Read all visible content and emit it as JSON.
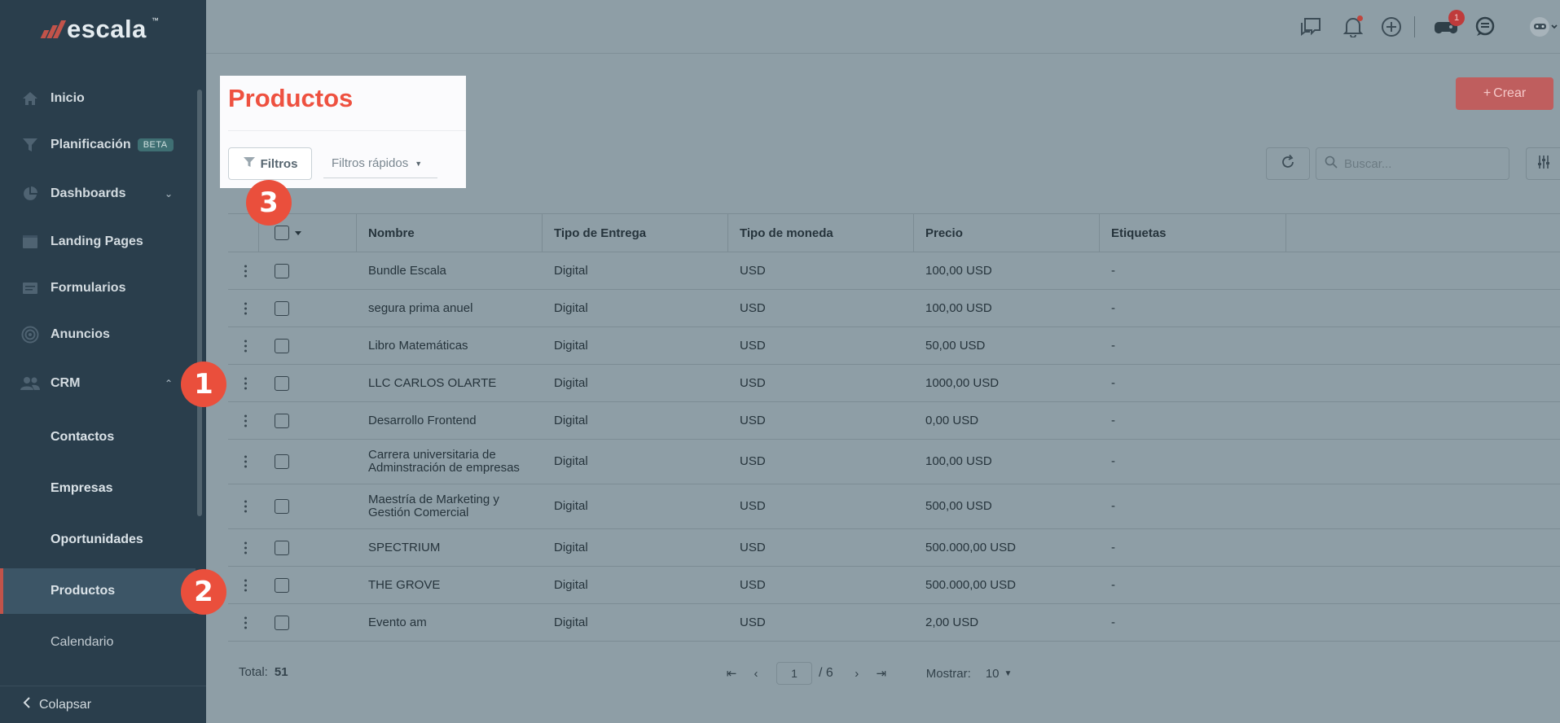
{
  "app": {
    "brand": "escala",
    "brand_mark": "™"
  },
  "sidebar": {
    "items": [
      {
        "label": "Inicio",
        "icon": "home-icon"
      },
      {
        "label": "Planificación",
        "icon": "funnel-icon",
        "badge": "BETA"
      },
      {
        "label": "Dashboards",
        "icon": "pie-chart-icon"
      },
      {
        "label": "Landing Pages",
        "icon": "browser-icon"
      },
      {
        "label": "Formularios",
        "icon": "form-icon"
      },
      {
        "label": "Anuncios",
        "icon": "target-icon"
      },
      {
        "label": "CRM",
        "icon": "users-icon"
      }
    ],
    "crm_subitems": [
      "Contactos",
      "Empresas",
      "Oportunidades",
      "Productos",
      "Calendario"
    ],
    "active_subitem": "Productos",
    "collapse_label": "Colapsar"
  },
  "topbar": {
    "icons": [
      "chat-bubbles-icon",
      "bell-icon",
      "plus-circle-icon",
      "gamepad-icon",
      "support-chat-icon",
      "robot-avatar-icon"
    ],
    "notification_count": "1"
  },
  "page": {
    "title": "Productos",
    "filters_label": "Filtros",
    "quick_filters_label": "Filtros rápidos",
    "create_label": "Crear",
    "search_placeholder": "Buscar..."
  },
  "table": {
    "columns": [
      "Nombre",
      "Tipo de Entrega",
      "Tipo de moneda",
      "Precio",
      "Etiquetas"
    ],
    "rows": [
      {
        "nombre": "Bundle Escala",
        "entrega": "Digital",
        "moneda": "USD",
        "precio": "100,00 USD",
        "etiquetas": "-"
      },
      {
        "nombre": "segura prima anuel",
        "entrega": "Digital",
        "moneda": "USD",
        "precio": "100,00 USD",
        "etiquetas": "-"
      },
      {
        "nombre": "Libro Matemáticas",
        "entrega": "Digital",
        "moneda": "USD",
        "precio": "50,00 USD",
        "etiquetas": "-"
      },
      {
        "nombre": "LLC CARLOS OLARTE",
        "entrega": "Digital",
        "moneda": "USD",
        "precio": "1000,00 USD",
        "etiquetas": "-"
      },
      {
        "nombre": "Desarrollo Frontend",
        "entrega": "Digital",
        "moneda": "USD",
        "precio": "0,00 USD",
        "etiquetas": "-"
      },
      {
        "nombre": "Carrera universitaria de Adminstración de empresas",
        "entrega": "Digital",
        "moneda": "USD",
        "precio": "100,00 USD",
        "etiquetas": "-"
      },
      {
        "nombre": "Maestría de Marketing y Gestión Comercial",
        "entrega": "Digital",
        "moneda": "USD",
        "precio": "500,00 USD",
        "etiquetas": "-"
      },
      {
        "nombre": "SPECTRIUM",
        "entrega": "Digital",
        "moneda": "USD",
        "precio": "500.000,00 USD",
        "etiquetas": "-"
      },
      {
        "nombre": "THE GROVE",
        "entrega": "Digital",
        "moneda": "USD",
        "precio": "500.000,00 USD",
        "etiquetas": "-"
      },
      {
        "nombre": "Evento am",
        "entrega": "Digital",
        "moneda": "USD",
        "precio": "2,00 USD",
        "etiquetas": "-"
      }
    ]
  },
  "footer": {
    "total_label": "Total:",
    "total_value": "51",
    "current_page": "1",
    "total_pages": "/ 6",
    "show_label": "Mostrar:",
    "per_page": "10"
  },
  "steps": [
    "1",
    "2",
    "3"
  ],
  "colors": {
    "accent": "#ee5140",
    "sidebar_bg": "#2a3e4c",
    "overlay": "#8e9ea6"
  }
}
